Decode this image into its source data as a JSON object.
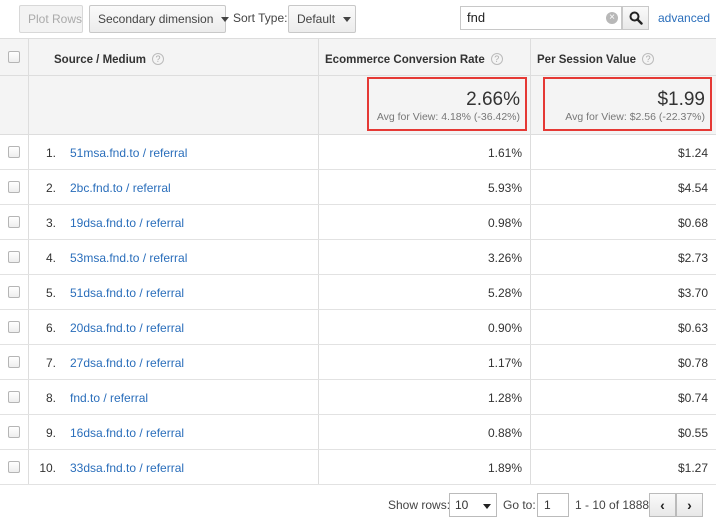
{
  "toolbar": {
    "plot_rows_label": "Plot Rows",
    "secondary_dimension_label": "Secondary dimension",
    "sort_type_label": "Sort Type:",
    "sort_type_value": "Default",
    "search_value": "fnd",
    "search_icon": "search-icon",
    "advanced_label": "advanced"
  },
  "table": {
    "columns": {
      "source_medium": "Source / Medium",
      "conversion_rate": "Ecommerce Conversion Rate",
      "per_session_value": "Per Session Value"
    },
    "summary": {
      "conversion_rate": "2.66%",
      "conversion_rate_avg": "Avg for View: 4.18% (-36.42%)",
      "per_session_value": "$1.99",
      "per_session_value_avg": "Avg for View: $2.56 (-22.37%)"
    },
    "highlight_color": "#e53935",
    "link_color": "#2a6ebb",
    "rows": [
      {
        "num": "1.",
        "source": "51msa.fnd.to / referral",
        "rate": "1.61%",
        "value": "$1.24"
      },
      {
        "num": "2.",
        "source": "2bc.fnd.to / referral",
        "rate": "5.93%",
        "value": "$4.54"
      },
      {
        "num": "3.",
        "source": "19dsa.fnd.to / referral",
        "rate": "0.98%",
        "value": "$0.68"
      },
      {
        "num": "4.",
        "source": "53msa.fnd.to / referral",
        "rate": "3.26%",
        "value": "$2.73"
      },
      {
        "num": "5.",
        "source": "51dsa.fnd.to / referral",
        "rate": "5.28%",
        "value": "$3.70"
      },
      {
        "num": "6.",
        "source": "20dsa.fnd.to / referral",
        "rate": "0.90%",
        "value": "$0.63"
      },
      {
        "num": "7.",
        "source": "27dsa.fnd.to / referral",
        "rate": "1.17%",
        "value": "$0.78"
      },
      {
        "num": "8.",
        "source": "fnd.to / referral",
        "rate": "1.28%",
        "value": "$0.74"
      },
      {
        "num": "9.",
        "source": "16dsa.fnd.to / referral",
        "rate": "0.88%",
        "value": "$0.55"
      },
      {
        "num": "10.",
        "source": "33dsa.fnd.to / referral",
        "rate": "1.89%",
        "value": "$1.27"
      }
    ]
  },
  "footer": {
    "show_rows_label": "Show rows:",
    "show_rows_value": "10",
    "goto_label": "Go to:",
    "goto_value": "1",
    "range_label": "1 - 10 of 1888",
    "prev_symbol": "‹",
    "next_symbol": "›"
  }
}
